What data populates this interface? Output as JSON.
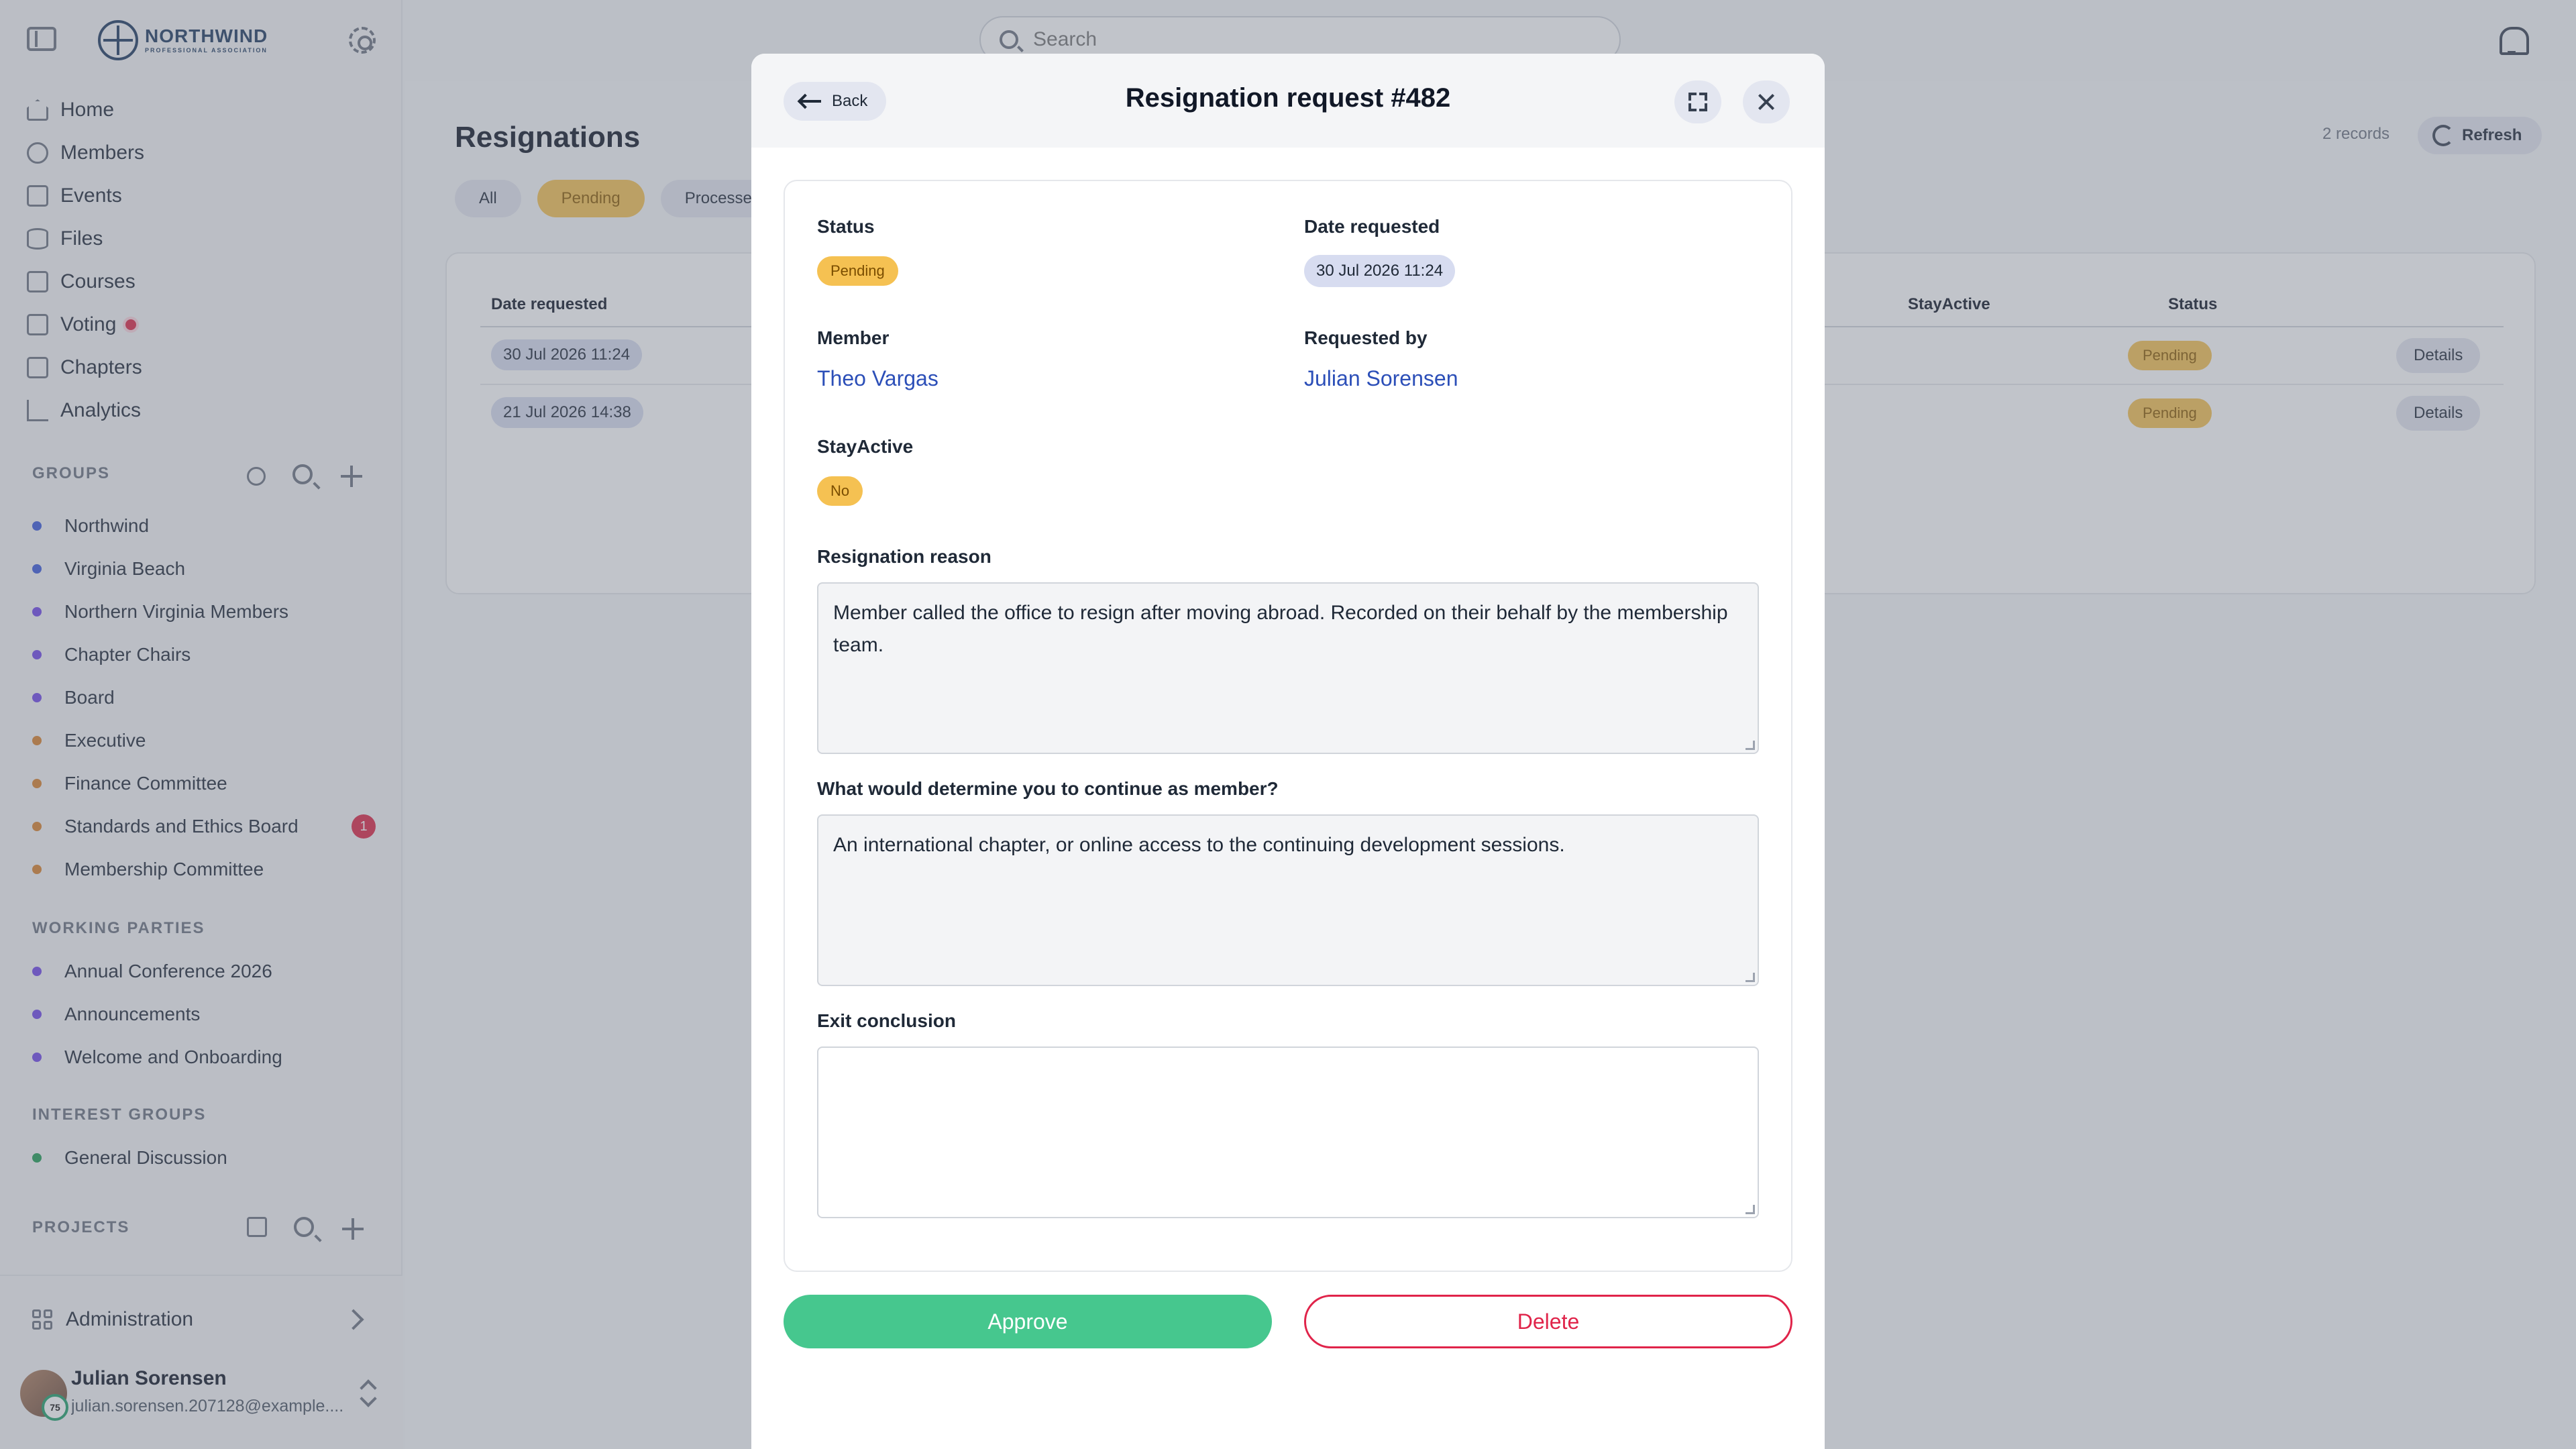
{
  "sidebar": {
    "brand": {
      "name": "NORTHWIND",
      "subtitle": "PROFESSIONAL ASSOCIATION"
    },
    "nav": [
      {
        "label": "Home",
        "icon": "home-icon"
      },
      {
        "label": "Members",
        "icon": "users-icon"
      },
      {
        "label": "Events",
        "icon": "calendar-icon"
      },
      {
        "label": "Files",
        "icon": "database-icon"
      },
      {
        "label": "Courses",
        "icon": "book-icon"
      },
      {
        "label": "Voting",
        "icon": "ballot-icon"
      },
      {
        "label": "Chapters",
        "icon": "chapters-icon"
      },
      {
        "label": "Analytics",
        "icon": "chart-icon"
      }
    ],
    "groups_title": "GROUPS",
    "groups": [
      {
        "label": "Northwind",
        "color": "#3b5bdb"
      },
      {
        "label": "Virginia Beach",
        "color": "#3b5bdb"
      },
      {
        "label": "Northern Virginia Members",
        "color": "#7048e8"
      },
      {
        "label": "Chapter Chairs",
        "color": "#7048e8"
      },
      {
        "label": "Board",
        "color": "#7048e8"
      },
      {
        "label": "Executive",
        "color": "#d9822b"
      },
      {
        "label": "Finance Committee",
        "color": "#d9822b"
      },
      {
        "label": "Standards and Ethics Board",
        "color": "#d9822b",
        "badge": "1"
      },
      {
        "label": "Membership Committee",
        "color": "#d9822b"
      }
    ],
    "working_parties_title": "WORKING PARTIES",
    "working_parties": [
      {
        "label": "Annual Conference 2026",
        "color": "#7048e8"
      },
      {
        "label": "Announcements",
        "color": "#7048e8"
      },
      {
        "label": "Welcome and Onboarding",
        "color": "#7048e8"
      }
    ],
    "interest_groups_title": "INTEREST GROUPS",
    "interest_groups": [
      {
        "label": "General Discussion",
        "color": "#1f9d55"
      }
    ],
    "projects_title": "PROJECTS",
    "admin_label": "Administration",
    "user": {
      "name": "Julian Sorensen",
      "email": "julian.sorensen.207128@example....",
      "level": "75"
    }
  },
  "header": {
    "search_placeholder": "Search"
  },
  "page": {
    "title": "Resignations",
    "tabs": [
      "All",
      "Pending",
      "Processed"
    ],
    "active_tab": "Pending",
    "records": "2 records",
    "refresh_label": "Refresh",
    "columns": {
      "date": "Date requested",
      "stay": "StayActive",
      "status": "Status"
    },
    "rows": [
      {
        "date": "30 Jul 2026 11:24",
        "status": "Pending",
        "action": "Details"
      },
      {
        "date": "21 Jul 2026 14:38",
        "status": "Pending",
        "action": "Details"
      }
    ]
  },
  "modal": {
    "back_label": "Back",
    "title": "Resignation request #482",
    "status_label": "Status",
    "status_value": "Pending",
    "date_label": "Date requested",
    "date_value": "30 Jul 2026 11:24",
    "member_label": "Member",
    "member_value": "Theo Vargas",
    "requested_by_label": "Requested by",
    "requested_by_value": "Julian Sorensen",
    "stay_label": "StayActive",
    "stay_value": "No",
    "reason_label": "Resignation reason",
    "reason_value": "Member called the office to resign after moving abroad. Recorded on their behalf by the membership team.",
    "continue_label": "What would determine you to continue as member?",
    "continue_value": "An international chapter, or online access to the continuing development sessions.",
    "exit_label": "Exit conclusion",
    "exit_value": "",
    "approve_label": "Approve",
    "delete_label": "Delete"
  }
}
